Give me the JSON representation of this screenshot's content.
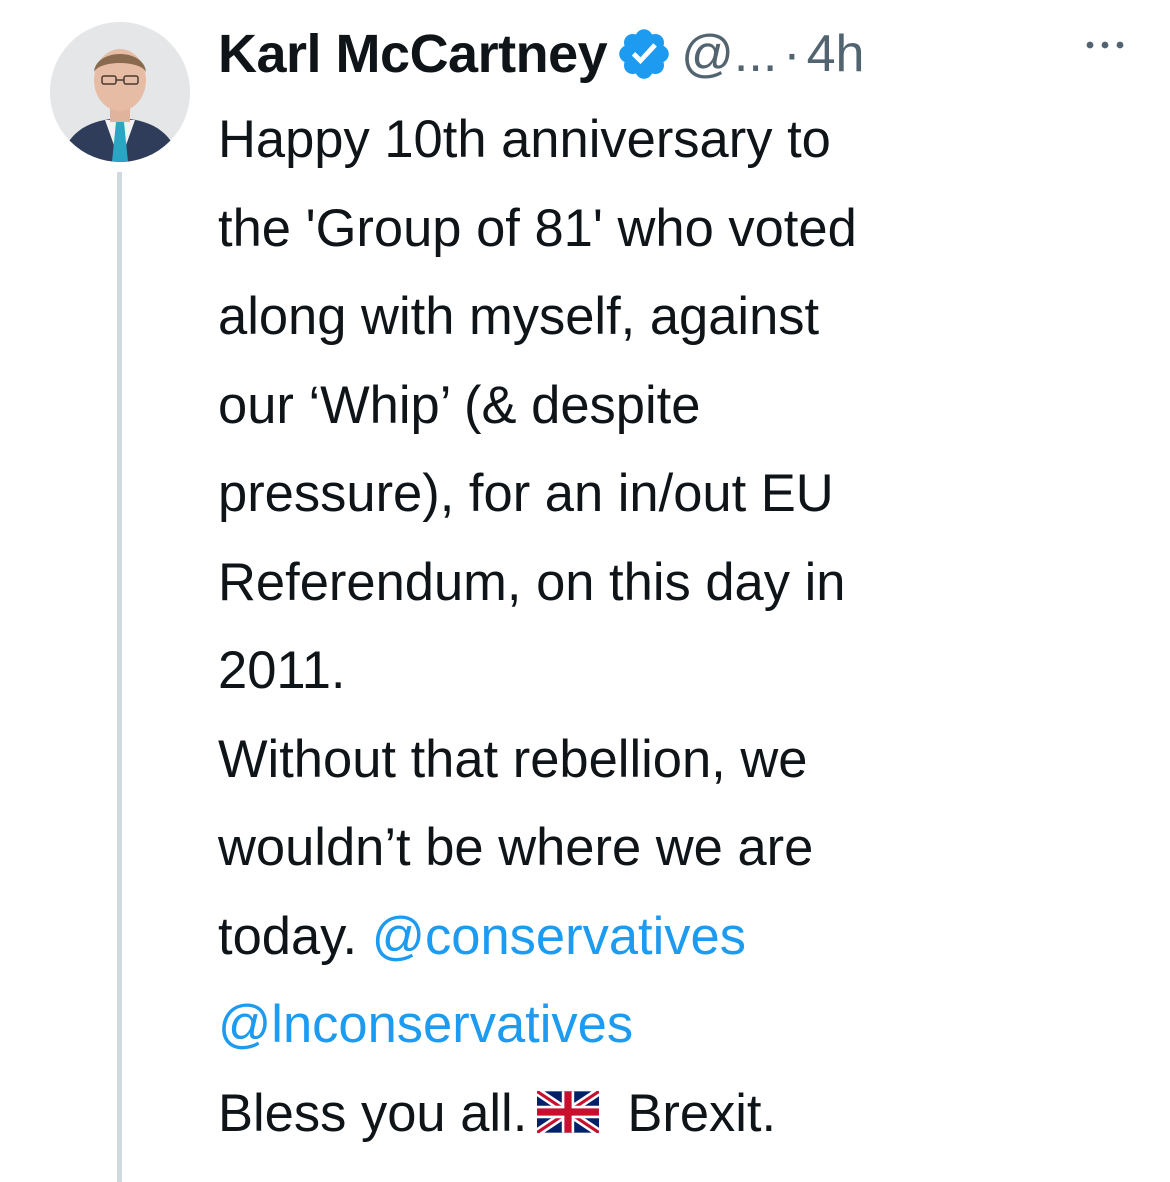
{
  "tweet": {
    "author": {
      "name": "Karl McCartney",
      "handle": "@...",
      "verified": true,
      "avatar_icon": "avatar-photo"
    },
    "separator": "·",
    "time": "4h",
    "more_icon": "more-horizontal-icon",
    "text_lines": [
      "Happy 10th anniversary to",
      "the 'Group of 81' who voted",
      "along with myself, against",
      "our ‘Whip’ (& despite",
      "pressure), for an in/out EU",
      "Referendum, on this day in",
      "2011.",
      "Without that rebellion, we",
      "wouldn’t be where we are",
      "today. "
    ],
    "mentions": [
      "@conservatives",
      "@lnconservatives"
    ],
    "closing_before": "Bless you all.",
    "closing_after": "Brexit.",
    "flag_icon": "uk-flag-icon"
  },
  "colors": {
    "text": "#0f1419",
    "secondary": "#536471",
    "link": "#1d9bf0",
    "thread_line": "#cfd9de"
  }
}
